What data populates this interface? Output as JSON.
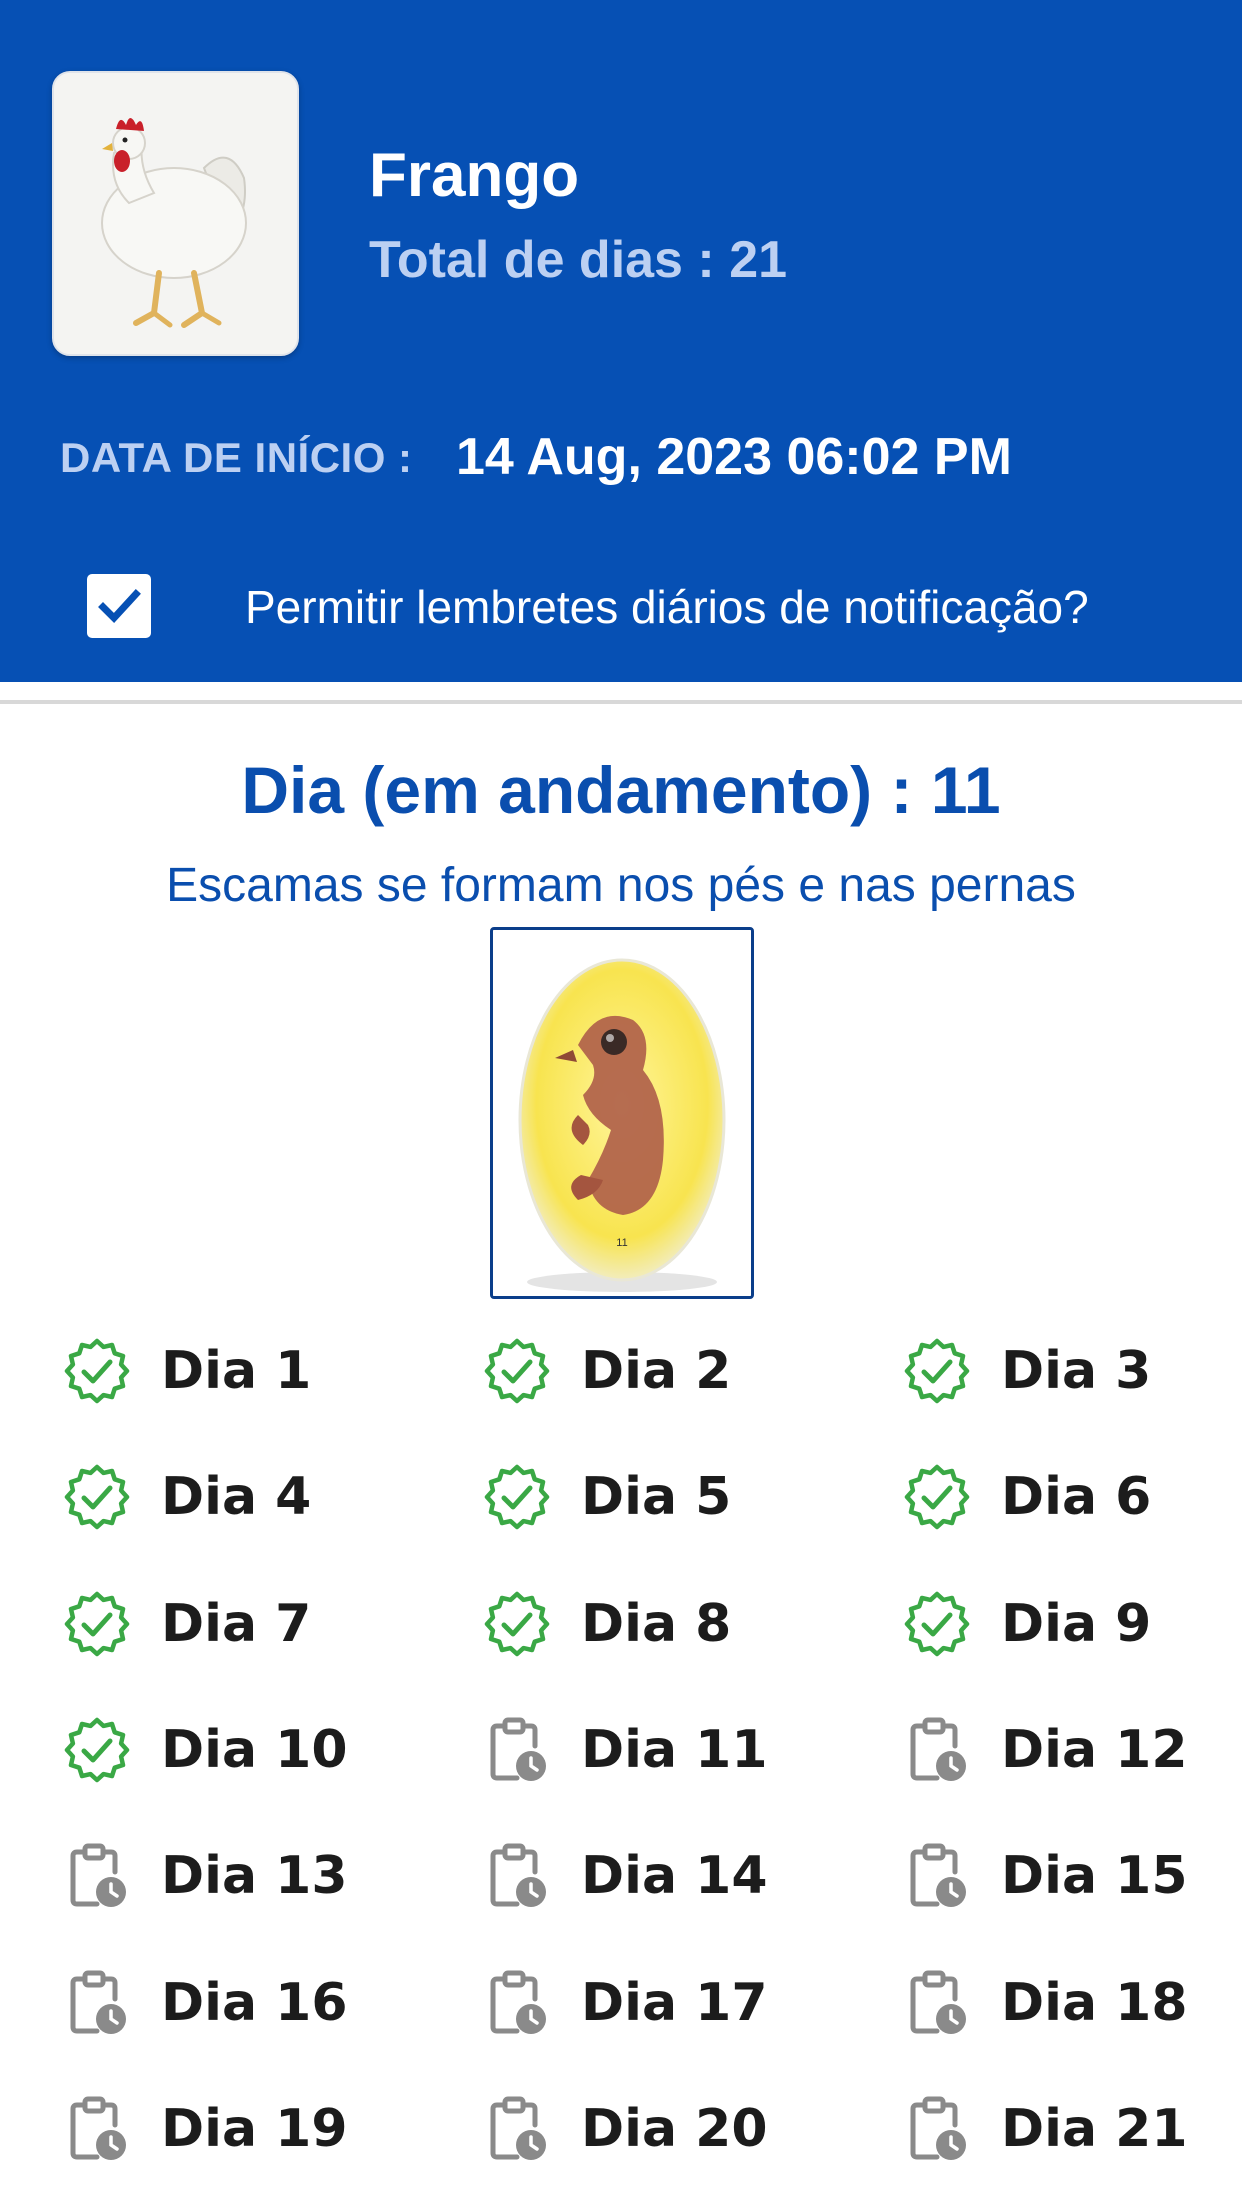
{
  "header": {
    "title": "Frango",
    "total_days": "Total de dias : 21",
    "start_label": "DATA DE INÍCIO :",
    "start_value": "14 Aug, 2023 06:02 PM",
    "notify_label": "Permitir lembretes diários de notificação?",
    "notify_checked": true,
    "background_color": "#0650B4"
  },
  "current_day": {
    "heading": "Dia (em andamento) : 11",
    "description": "Escamas se formam nos pés e nas pernas",
    "image_caption": "11"
  },
  "days": [
    {
      "label": "Dia 1",
      "status": "done"
    },
    {
      "label": "Dia 2",
      "status": "done"
    },
    {
      "label": "Dia 3",
      "status": "done"
    },
    {
      "label": "Dia 4",
      "status": "done"
    },
    {
      "label": "Dia 5",
      "status": "done"
    },
    {
      "label": "Dia 6",
      "status": "done"
    },
    {
      "label": "Dia 7",
      "status": "done"
    },
    {
      "label": "Dia 8",
      "status": "done"
    },
    {
      "label": "Dia 9",
      "status": "done"
    },
    {
      "label": "Dia 10",
      "status": "done"
    },
    {
      "label": "Dia 11",
      "status": "pending"
    },
    {
      "label": "Dia 12",
      "status": "pending"
    },
    {
      "label": "Dia 13",
      "status": "pending"
    },
    {
      "label": "Dia 14",
      "status": "pending"
    },
    {
      "label": "Dia 15",
      "status": "pending"
    },
    {
      "label": "Dia 16",
      "status": "pending"
    },
    {
      "label": "Dia 17",
      "status": "pending"
    },
    {
      "label": "Dia 18",
      "status": "pending"
    },
    {
      "label": "Dia 19",
      "status": "pending"
    },
    {
      "label": "Dia 20",
      "status": "pending"
    },
    {
      "label": "Dia 21",
      "status": "pending"
    }
  ],
  "icons": {
    "done": "verified-check-icon",
    "pending": "clipboard-clock-icon"
  },
  "colors": {
    "done_icon": "#3aa845",
    "pending_icon": "#8a8a8a",
    "accent_text": "#0a4eae"
  }
}
